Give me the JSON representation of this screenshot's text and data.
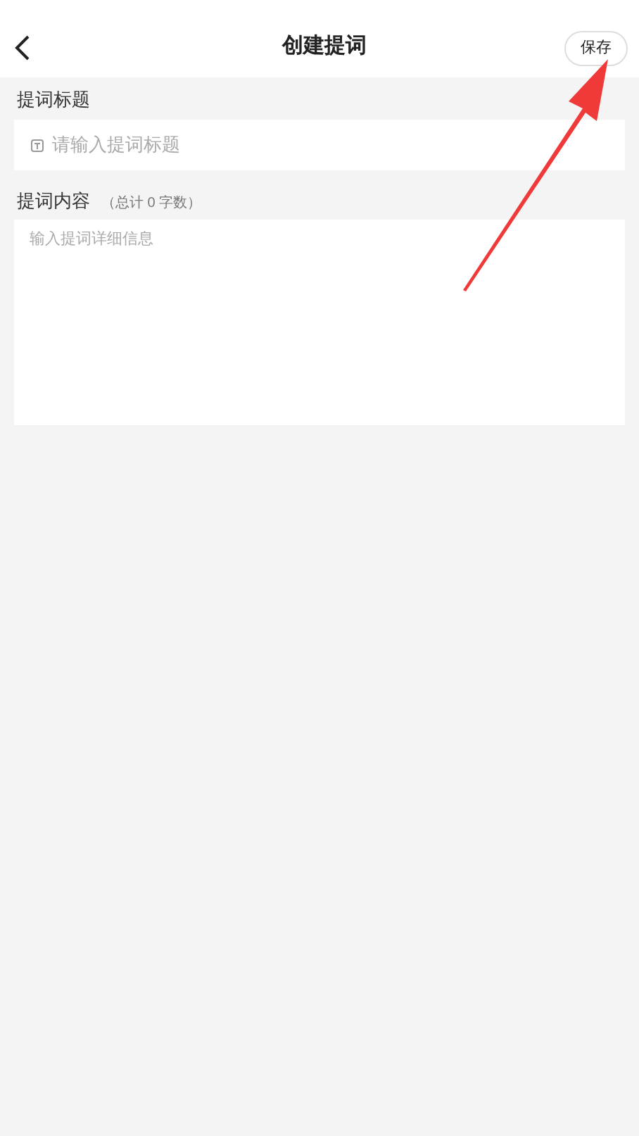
{
  "header": {
    "title": "创建提词",
    "save_button": "保存"
  },
  "title_field": {
    "label": "提词标题",
    "placeholder": "请输入提词标题"
  },
  "content_field": {
    "label": "提词内容",
    "count": "（总计 0 字数）",
    "placeholder": "输入提词详细信息"
  },
  "annotation": {
    "kind": "arrow"
  }
}
